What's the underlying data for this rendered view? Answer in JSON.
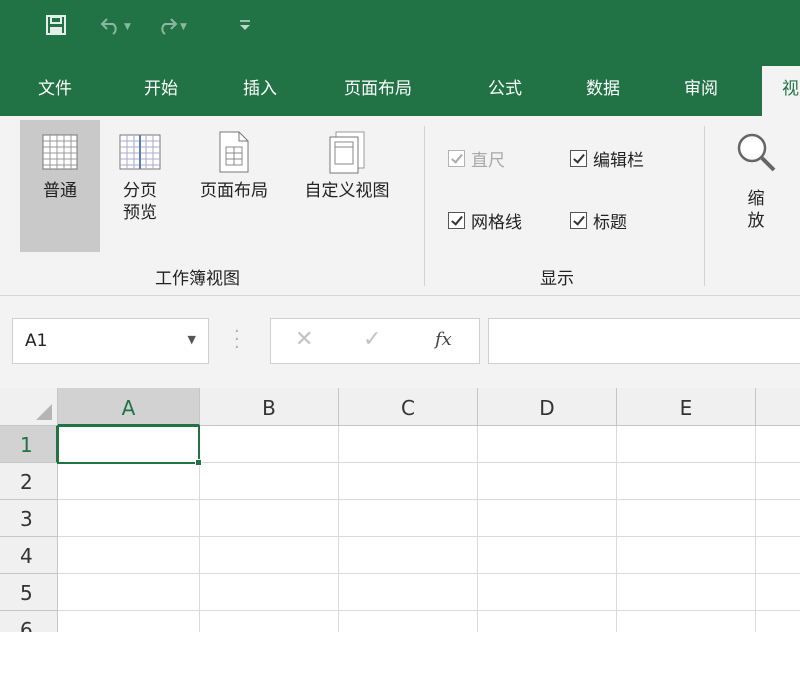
{
  "qat": {
    "save_icon": "save-icon",
    "undo_icon": "undo-icon",
    "redo_icon": "redo-icon",
    "customize_icon": "customize-qat-icon"
  },
  "tabs": [
    {
      "label": "文件"
    },
    {
      "label": "开始"
    },
    {
      "label": "插入"
    },
    {
      "label": "页面布局"
    },
    {
      "label": "公式"
    },
    {
      "label": "数据"
    },
    {
      "label": "审阅"
    },
    {
      "label": "视",
      "active": true
    }
  ],
  "ribbon": {
    "workbook_views": {
      "label": "工作簿视图",
      "normal": "普通",
      "page_break_1": "分页",
      "page_break_2": "预览",
      "page_layout": "页面布局",
      "custom_views": "自定义视图"
    },
    "show": {
      "label": "显示",
      "ruler": {
        "label": "直尺",
        "checked": true,
        "enabled": false
      },
      "formula_bar": {
        "label": "编辑栏",
        "checked": true,
        "enabled": true
      },
      "gridlines": {
        "label": "网格线",
        "checked": true,
        "enabled": true
      },
      "headings": {
        "label": "标题",
        "checked": true,
        "enabled": true
      }
    },
    "zoom": {
      "label_1": "缩",
      "label_2": "放"
    }
  },
  "formula_bar": {
    "name_box": "A1",
    "cancel_glyph": "✕",
    "enter_glyph": "✓",
    "fx_glyph": "fx",
    "formula": ""
  },
  "sheet": {
    "columns": [
      "A",
      "B",
      "C",
      "D",
      "E"
    ],
    "rows": [
      "1",
      "2",
      "3",
      "4",
      "5",
      "6"
    ],
    "active_cell": "A1"
  },
  "colors": {
    "brand": "#217346",
    "ribbon_bg": "#f3f3f3",
    "header_bg": "#f0f0f0"
  }
}
